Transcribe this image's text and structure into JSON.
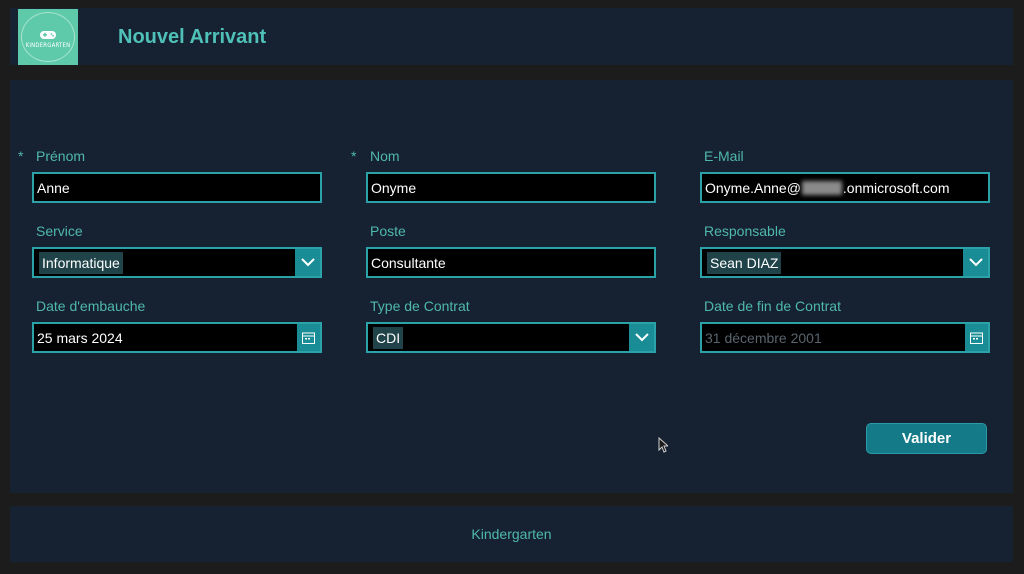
{
  "header": {
    "title": "Nouvel Arrivant",
    "logo_text": "KINDERGARTEN"
  },
  "form": {
    "required_marker": "*",
    "prenom": {
      "label": "Prénom",
      "value": "Anne",
      "required": true
    },
    "nom": {
      "label": "Nom",
      "value": "Onyme",
      "required": true
    },
    "email": {
      "label": "E-Mail",
      "value_prefix": "Onyme.Anne@",
      "value_suffix": ".onmicrosoft.com"
    },
    "service": {
      "label": "Service",
      "value": "Informatique"
    },
    "poste": {
      "label": "Poste",
      "value": "Consultante"
    },
    "responsable": {
      "label": "Responsable",
      "value": "Sean DIAZ"
    },
    "date_embauche": {
      "label": "Date d'embauche",
      "value": "25 mars 2024"
    },
    "type_contrat": {
      "label": "Type de Contrat",
      "value": "CDI"
    },
    "date_fin_contrat": {
      "label": "Date de fin de Contrat",
      "placeholder": "31 décembre 2001"
    },
    "submit_label": "Valider"
  },
  "footer": {
    "text": "Kindergarten"
  },
  "colors": {
    "accent": "#4fb8ad",
    "button": "#157a88",
    "panel": "#162231",
    "background": "#1c1c1c"
  },
  "icons": {
    "dropdown": "chevron-down-icon",
    "calendar": "calendar-icon",
    "logo": "gamepad-icon",
    "cursor": "mouse-cursor-icon"
  }
}
